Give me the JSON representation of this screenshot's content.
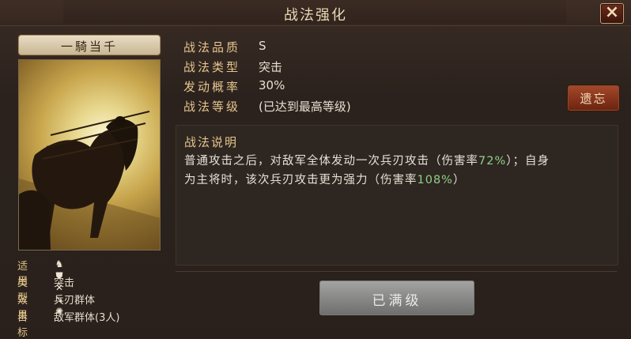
{
  "window": {
    "title": "战法强化",
    "close_icon": "close-icon"
  },
  "card": {
    "name": "一騎当千",
    "attributes": [
      {
        "label": "适用",
        "icons": [
          "cavalry-icon",
          "shield-icon",
          "archer-icon",
          "spear-icon",
          "siege-icon"
        ]
      },
      {
        "label": "类型",
        "value": "突击"
      },
      {
        "label": "效果",
        "value": "兵刃群体"
      },
      {
        "label": "目标",
        "value": "敌军群体(3人)"
      }
    ]
  },
  "info": {
    "rows": [
      {
        "label": "战法品质",
        "value": "S"
      },
      {
        "label": "战法类型",
        "value": "突击"
      },
      {
        "label": "发动概率",
        "value": "30%"
      },
      {
        "label": "战法等级",
        "value": "(已达到最高等级)"
      }
    ],
    "forget_button": "遗忘"
  },
  "description": {
    "title": "战法说明",
    "line1_prefix": "普通攻击之后，对敌军全体发动一次兵刃攻击（伤害率",
    "line1_pct": "72%",
    "line1_suffix": "）；自身",
    "line2_prefix": "为主将时，该次兵刃攻击更为强力（伤害率",
    "line2_pct": "108%",
    "line2_suffix": "）",
    "highlight_color": "#8fd08a"
  },
  "action": {
    "max_level_button": "已满级"
  }
}
